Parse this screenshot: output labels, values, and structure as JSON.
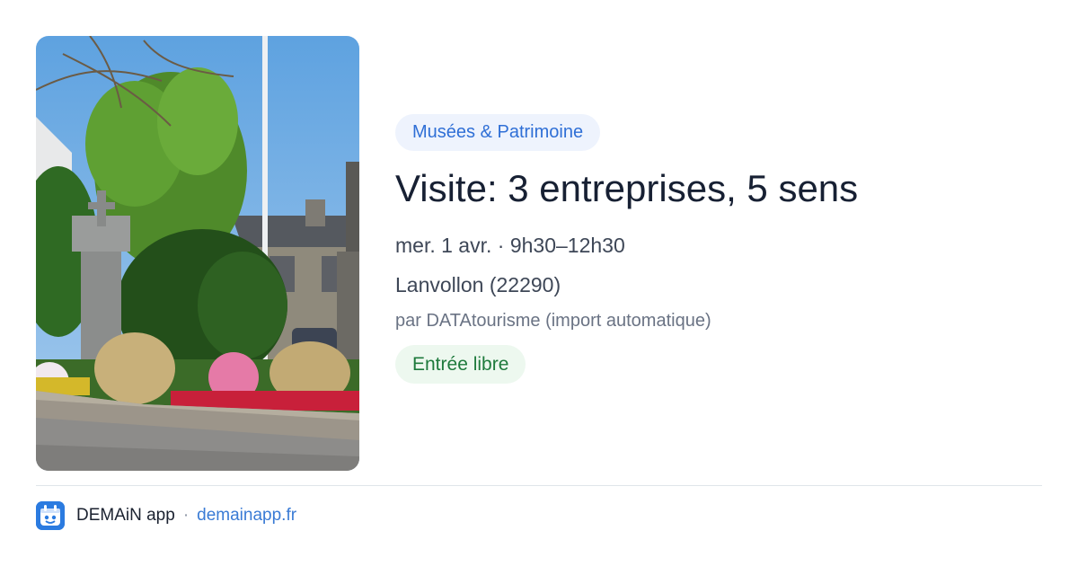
{
  "event": {
    "category": "Musées & Patrimoine",
    "title": "Visite: 3 entreprises, 5 sens",
    "date": "mer. 1 avr. · 9h30–12h30",
    "location": "Lanvollon (22290)",
    "organizer": "par DATAtourisme (import automatique)",
    "price": "Entrée libre"
  },
  "footer": {
    "logo_icon": "demain-app-logo-icon",
    "app_name": "DEMAiN app",
    "separator": "·",
    "url": "demainapp.fr"
  },
  "colors": {
    "category_bg": "#eef3fd",
    "category_text": "#2f6fd6",
    "price_bg": "#edf8ef",
    "price_text": "#1e7a3c",
    "link": "#3a7bd5",
    "logo_bg": "#2b7be0"
  }
}
